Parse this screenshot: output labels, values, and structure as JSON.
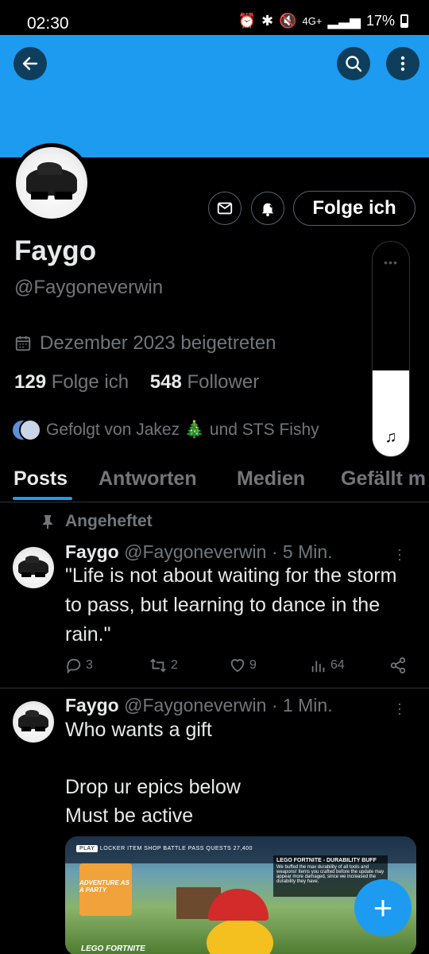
{
  "status_bar": {
    "time": "02:30",
    "network": "4G+",
    "battery": "17%"
  },
  "profile": {
    "name": "Faygo",
    "handle": "@Faygoneverwin",
    "joined": "Dezember 2023 beigetreten",
    "following_count": "129",
    "following_label": "Folge ich",
    "followers_count": "548",
    "followers_label": "Follower",
    "followed_by": "Gefolgt von Jakez 🎄 und STS Fishy",
    "follow_button": "Folge ich"
  },
  "volume": {
    "level": 0.4
  },
  "tabs": [
    "Posts",
    "Antworten",
    "Medien",
    "Gefällt m"
  ],
  "active_tab": "Posts",
  "posts": [
    {
      "pinned_label": "Angeheftet",
      "name": "Faygo",
      "meta": "@Faygoneverwin · 5 Min.",
      "text": "\"Life is not about waiting for the storm to pass, but learning to dance in the rain.\"",
      "replies": "3",
      "reposts": "2",
      "likes": "9",
      "views": "64"
    },
    {
      "name": "Faygo",
      "meta": "@Faygoneverwin · 1 Min.",
      "text": "Who wants a gift\n\nDrop ur epics below\nMust be active",
      "media": {
        "menu_play": "PLAY",
        "menu_items": "LOCKER   ITEM SHOP   BATTLE PASS   QUESTS   27,400",
        "card_title": "ADVENTURE AS A PARTY",
        "buff_title": "LEGO FORTNITE - DURABILITY BUFF",
        "buff_text": "We buffed the max durability of all tools and weapons! Items you crafted before the update may appear more damaged, since we increased the durability they have.",
        "label": "LEGO FORTNITE"
      }
    }
  ],
  "icons": {
    "back": "back-arrow-icon",
    "search": "search-icon",
    "more": "more-vertical-icon",
    "mail": "mail-icon",
    "bell": "bell-icon",
    "compose": "plus-icon"
  },
  "colors": {
    "accent": "#1d9bf0",
    "background": "#000000",
    "secondary_text": "#71767b"
  }
}
